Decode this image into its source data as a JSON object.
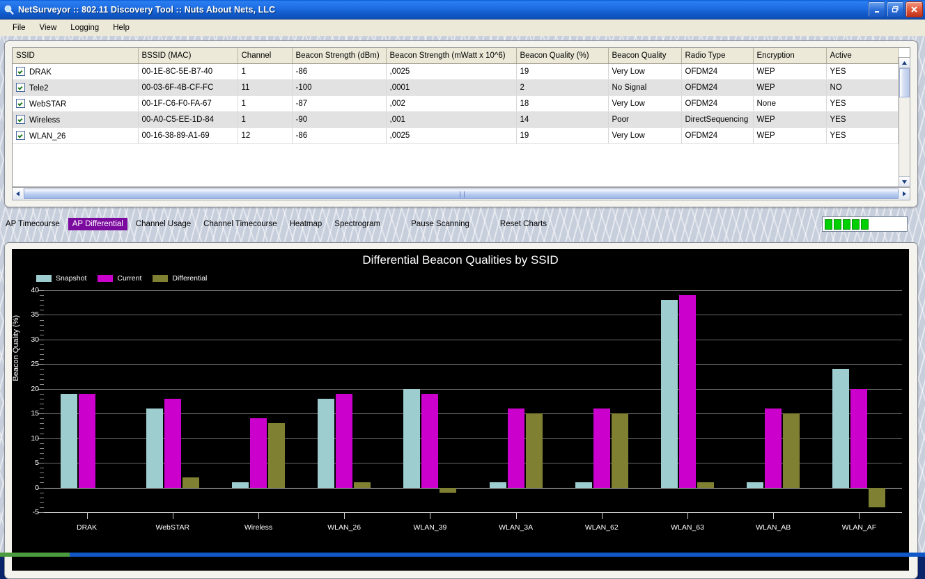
{
  "window": {
    "title": "NetSurveyor :: 802.11 Discovery Tool :: Nuts About Nets, LLC",
    "icon": "magnifier-icon",
    "minimize_label": "_",
    "maximize_label": "❐",
    "close_label": "✕"
  },
  "menu": {
    "items": [
      "File",
      "View",
      "Logging",
      "Help"
    ]
  },
  "table": {
    "columns": [
      "SSID",
      "BSSID (MAC)",
      "Channel",
      "Beacon Strength (dBm)",
      "Beacon Strength (mWatt x 10^6)",
      "Beacon Quality (%)",
      "Beacon Quality",
      "Radio Type",
      "Encryption",
      "Active"
    ],
    "rows": [
      {
        "checked": true,
        "ssid": "DRAK",
        "bssid": "00-1E-8C-5E-B7-40",
        "channel": "1",
        "strength_dbm": "-86",
        "strength_mwatt": ",0025",
        "quality_pct": "19",
        "quality": "Very Low",
        "radio_type": "OFDM24",
        "encryption": "WEP",
        "active": "YES"
      },
      {
        "checked": true,
        "ssid": "Tele2",
        "bssid": "00-03-6F-4B-CF-FC",
        "channel": "11",
        "strength_dbm": "-100",
        "strength_mwatt": ",0001",
        "quality_pct": "2",
        "quality": "No Signal",
        "radio_type": "OFDM24",
        "encryption": "WEP",
        "active": "NO"
      },
      {
        "checked": true,
        "ssid": "WebSTAR",
        "bssid": "00-1F-C6-F0-FA-67",
        "channel": "1",
        "strength_dbm": "-87",
        "strength_mwatt": ",002",
        "quality_pct": "18",
        "quality": "Very Low",
        "radio_type": "OFDM24",
        "encryption": "None",
        "active": "YES"
      },
      {
        "checked": true,
        "ssid": "Wireless",
        "bssid": "00-A0-C5-EE-1D-84",
        "channel": "1",
        "strength_dbm": "-90",
        "strength_mwatt": ",001",
        "quality_pct": "14",
        "quality": "Poor",
        "radio_type": "DirectSequencing",
        "encryption": "WEP",
        "active": "YES"
      },
      {
        "checked": true,
        "ssid": "WLAN_26",
        "bssid": "00-16-38-89-A1-69",
        "channel": "12",
        "strength_dbm": "-86",
        "strength_mwatt": ",0025",
        "quality_pct": "19",
        "quality": "Very Low",
        "radio_type": "OFDM24",
        "encryption": "WEP",
        "active": "YES"
      }
    ]
  },
  "tabs": {
    "items": [
      {
        "label": "AP Timecourse",
        "selected": false
      },
      {
        "label": "AP Differential",
        "selected": true
      },
      {
        "label": "Channel Usage",
        "selected": false
      },
      {
        "label": "Channel Timecourse",
        "selected": false
      },
      {
        "label": "Heatmap",
        "selected": false
      },
      {
        "label": "Spectrogram",
        "selected": false
      }
    ],
    "actions": [
      {
        "label": "Pause Scanning"
      },
      {
        "label": "Reset Charts"
      }
    ],
    "meter": {
      "bars": 5,
      "color": "#00d000"
    }
  },
  "chart_data": {
    "type": "bar",
    "title": "Differential Beacon Qualities by SSID",
    "xlabel": "",
    "ylabel": "Beacon Quality (%)",
    "ylim": [
      -5,
      40
    ],
    "ytick_step": 5,
    "yticks": [
      -5,
      0,
      5,
      10,
      15,
      20,
      25,
      30,
      35,
      40
    ],
    "grid": true,
    "legend_position": "top-left",
    "background": "#000000",
    "categories": [
      "DRAK",
      "WebSTAR",
      "Wireless",
      "WLAN_26",
      "WLAN_39",
      "WLAN_3A",
      "WLAN_62",
      "WLAN_63",
      "WLAN_AB",
      "WLAN_AF"
    ],
    "series": [
      {
        "name": "Snapshot",
        "color": "#9ecdd0",
        "values": [
          19,
          16,
          1,
          18,
          20,
          1,
          1,
          38,
          1,
          24
        ]
      },
      {
        "name": "Current",
        "color": "#cc00cc",
        "values": [
          19,
          18,
          14,
          19,
          19,
          16,
          16,
          39,
          16,
          20
        ]
      },
      {
        "name": "Differential",
        "color": "#808033",
        "values": [
          0,
          2,
          13,
          1,
          -1,
          15,
          15,
          1,
          15,
          -4
        ]
      }
    ]
  }
}
